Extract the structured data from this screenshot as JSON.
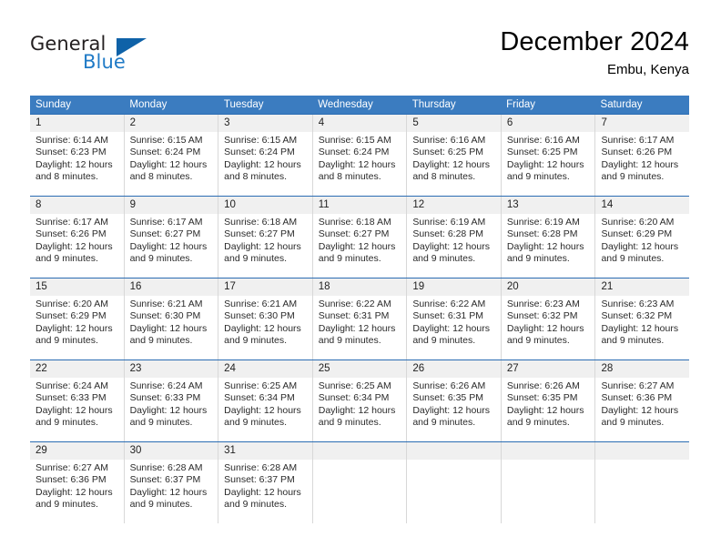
{
  "brand": {
    "name_top": "General",
    "name_bottom": "Blue",
    "triangle_color": "#0f62a8",
    "blue_text_color": "#1f7ac6"
  },
  "header": {
    "month_title": "December 2024",
    "location": "Embu, Kenya"
  },
  "colors": {
    "header_row_bg": "#3b7cc0",
    "week_divider": "#2b6cb3",
    "day_number_bg": "#f0f0f0",
    "cell_border": "#d8d8d8"
  },
  "weekdays": [
    "Sunday",
    "Monday",
    "Tuesday",
    "Wednesday",
    "Thursday",
    "Friday",
    "Saturday"
  ],
  "weeks": [
    [
      {
        "day": "1",
        "sunrise": "Sunrise: 6:14 AM",
        "sunset": "Sunset: 6:23 PM",
        "daylight": "Daylight: 12 hours and 8 minutes."
      },
      {
        "day": "2",
        "sunrise": "Sunrise: 6:15 AM",
        "sunset": "Sunset: 6:24 PM",
        "daylight": "Daylight: 12 hours and 8 minutes."
      },
      {
        "day": "3",
        "sunrise": "Sunrise: 6:15 AM",
        "sunset": "Sunset: 6:24 PM",
        "daylight": "Daylight: 12 hours and 8 minutes."
      },
      {
        "day": "4",
        "sunrise": "Sunrise: 6:15 AM",
        "sunset": "Sunset: 6:24 PM",
        "daylight": "Daylight: 12 hours and 8 minutes."
      },
      {
        "day": "5",
        "sunrise": "Sunrise: 6:16 AM",
        "sunset": "Sunset: 6:25 PM",
        "daylight": "Daylight: 12 hours and 8 minutes."
      },
      {
        "day": "6",
        "sunrise": "Sunrise: 6:16 AM",
        "sunset": "Sunset: 6:25 PM",
        "daylight": "Daylight: 12 hours and 9 minutes."
      },
      {
        "day": "7",
        "sunrise": "Sunrise: 6:17 AM",
        "sunset": "Sunset: 6:26 PM",
        "daylight": "Daylight: 12 hours and 9 minutes."
      }
    ],
    [
      {
        "day": "8",
        "sunrise": "Sunrise: 6:17 AM",
        "sunset": "Sunset: 6:26 PM",
        "daylight": "Daylight: 12 hours and 9 minutes."
      },
      {
        "day": "9",
        "sunrise": "Sunrise: 6:17 AM",
        "sunset": "Sunset: 6:27 PM",
        "daylight": "Daylight: 12 hours and 9 minutes."
      },
      {
        "day": "10",
        "sunrise": "Sunrise: 6:18 AM",
        "sunset": "Sunset: 6:27 PM",
        "daylight": "Daylight: 12 hours and 9 minutes."
      },
      {
        "day": "11",
        "sunrise": "Sunrise: 6:18 AM",
        "sunset": "Sunset: 6:27 PM",
        "daylight": "Daylight: 12 hours and 9 minutes."
      },
      {
        "day": "12",
        "sunrise": "Sunrise: 6:19 AM",
        "sunset": "Sunset: 6:28 PM",
        "daylight": "Daylight: 12 hours and 9 minutes."
      },
      {
        "day": "13",
        "sunrise": "Sunrise: 6:19 AM",
        "sunset": "Sunset: 6:28 PM",
        "daylight": "Daylight: 12 hours and 9 minutes."
      },
      {
        "day": "14",
        "sunrise": "Sunrise: 6:20 AM",
        "sunset": "Sunset: 6:29 PM",
        "daylight": "Daylight: 12 hours and 9 minutes."
      }
    ],
    [
      {
        "day": "15",
        "sunrise": "Sunrise: 6:20 AM",
        "sunset": "Sunset: 6:29 PM",
        "daylight": "Daylight: 12 hours and 9 minutes."
      },
      {
        "day": "16",
        "sunrise": "Sunrise: 6:21 AM",
        "sunset": "Sunset: 6:30 PM",
        "daylight": "Daylight: 12 hours and 9 minutes."
      },
      {
        "day": "17",
        "sunrise": "Sunrise: 6:21 AM",
        "sunset": "Sunset: 6:30 PM",
        "daylight": "Daylight: 12 hours and 9 minutes."
      },
      {
        "day": "18",
        "sunrise": "Sunrise: 6:22 AM",
        "sunset": "Sunset: 6:31 PM",
        "daylight": "Daylight: 12 hours and 9 minutes."
      },
      {
        "day": "19",
        "sunrise": "Sunrise: 6:22 AM",
        "sunset": "Sunset: 6:31 PM",
        "daylight": "Daylight: 12 hours and 9 minutes."
      },
      {
        "day": "20",
        "sunrise": "Sunrise: 6:23 AM",
        "sunset": "Sunset: 6:32 PM",
        "daylight": "Daylight: 12 hours and 9 minutes."
      },
      {
        "day": "21",
        "sunrise": "Sunrise: 6:23 AM",
        "sunset": "Sunset: 6:32 PM",
        "daylight": "Daylight: 12 hours and 9 minutes."
      }
    ],
    [
      {
        "day": "22",
        "sunrise": "Sunrise: 6:24 AM",
        "sunset": "Sunset: 6:33 PM",
        "daylight": "Daylight: 12 hours and 9 minutes."
      },
      {
        "day": "23",
        "sunrise": "Sunrise: 6:24 AM",
        "sunset": "Sunset: 6:33 PM",
        "daylight": "Daylight: 12 hours and 9 minutes."
      },
      {
        "day": "24",
        "sunrise": "Sunrise: 6:25 AM",
        "sunset": "Sunset: 6:34 PM",
        "daylight": "Daylight: 12 hours and 9 minutes."
      },
      {
        "day": "25",
        "sunrise": "Sunrise: 6:25 AM",
        "sunset": "Sunset: 6:34 PM",
        "daylight": "Daylight: 12 hours and 9 minutes."
      },
      {
        "day": "26",
        "sunrise": "Sunrise: 6:26 AM",
        "sunset": "Sunset: 6:35 PM",
        "daylight": "Daylight: 12 hours and 9 minutes."
      },
      {
        "day": "27",
        "sunrise": "Sunrise: 6:26 AM",
        "sunset": "Sunset: 6:35 PM",
        "daylight": "Daylight: 12 hours and 9 minutes."
      },
      {
        "day": "28",
        "sunrise": "Sunrise: 6:27 AM",
        "sunset": "Sunset: 6:36 PM",
        "daylight": "Daylight: 12 hours and 9 minutes."
      }
    ],
    [
      {
        "day": "29",
        "sunrise": "Sunrise: 6:27 AM",
        "sunset": "Sunset: 6:36 PM",
        "daylight": "Daylight: 12 hours and 9 minutes."
      },
      {
        "day": "30",
        "sunrise": "Sunrise: 6:28 AM",
        "sunset": "Sunset: 6:37 PM",
        "daylight": "Daylight: 12 hours and 9 minutes."
      },
      {
        "day": "31",
        "sunrise": "Sunrise: 6:28 AM",
        "sunset": "Sunset: 6:37 PM",
        "daylight": "Daylight: 12 hours and 9 minutes."
      },
      {
        "day": "",
        "sunrise": "",
        "sunset": "",
        "daylight": ""
      },
      {
        "day": "",
        "sunrise": "",
        "sunset": "",
        "daylight": ""
      },
      {
        "day": "",
        "sunrise": "",
        "sunset": "",
        "daylight": ""
      },
      {
        "day": "",
        "sunrise": "",
        "sunset": "",
        "daylight": ""
      }
    ]
  ]
}
